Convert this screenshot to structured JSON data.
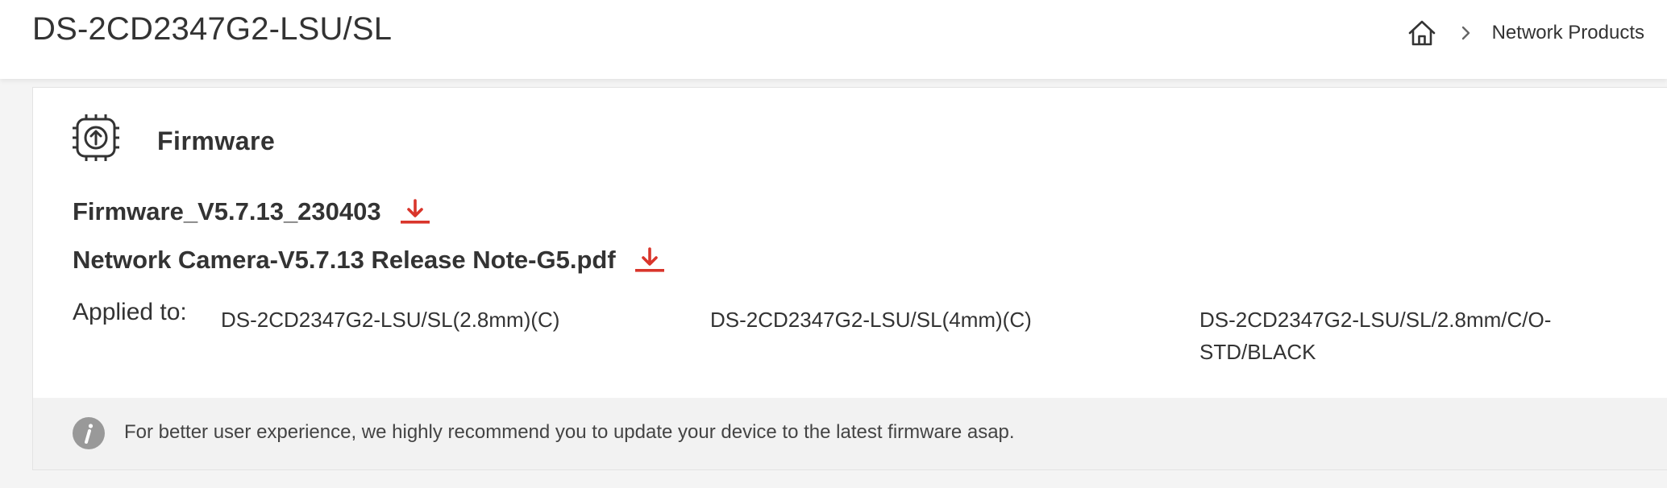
{
  "header": {
    "title": "DS-2CD2347G2-LSU/SL",
    "breadcrumb": {
      "home_icon": "home-icon",
      "separator_icon": "chevron-right-icon",
      "current": "Network Products"
    }
  },
  "firmware": {
    "icon": "chip-upload-icon",
    "title": "Firmware",
    "files": [
      {
        "name": "Firmware_V5.7.13_230403",
        "icon": "download-icon"
      },
      {
        "name": "Network Camera-V5.7.13 Release Note-G5.pdf",
        "icon": "download-icon"
      }
    ],
    "applied_label": "Applied to:",
    "models": [
      "DS-2CD2347G2-LSU/SL(2.8mm)(C)",
      "DS-2CD2347G2-LSU/SL(4mm)(C)",
      "DS-2CD2347G2-LSU/SL/2.8mm/C/O-STD/BLACK"
    ],
    "notice": {
      "icon": "info-icon",
      "text": "For better user experience, we highly recommend you to update your device to the latest firmware asap."
    }
  },
  "colors": {
    "accent": "#d9352b",
    "text": "#333333",
    "notice_bg": "#f2f2f2",
    "info_icon_bg": "#999999"
  }
}
